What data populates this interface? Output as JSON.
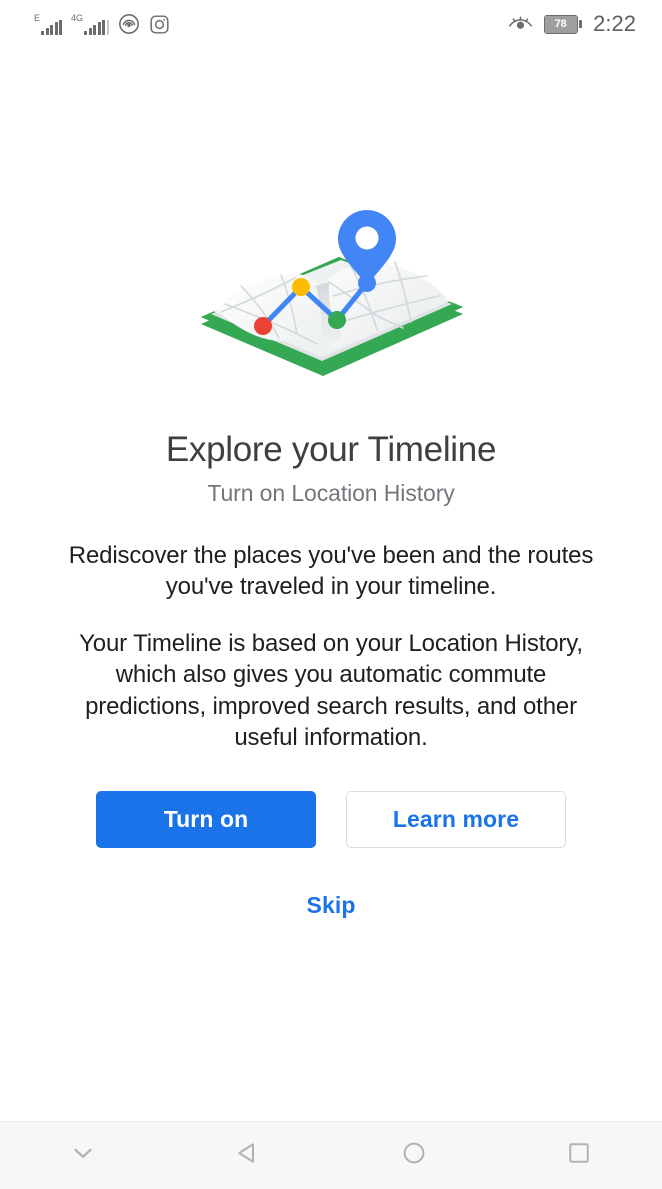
{
  "status_bar": {
    "signal_1_label": "E",
    "signal_2_label": "4G",
    "icons": [
      "signal-e-icon",
      "signal-4g-icon",
      "hotspot-icon",
      "instagram-icon",
      "eye-comfort-icon"
    ],
    "battery_level": "78",
    "time": "2:22"
  },
  "illustration": {
    "name": "timeline-book-map-illustration",
    "book_color": "#34a853",
    "page_color": "#f5f5f5",
    "pin_color": "#4285f4",
    "route_line_color": "#4285f4",
    "route_dots": [
      {
        "name": "route-dot-red",
        "color": "#ea4335"
      },
      {
        "name": "route-dot-yellow",
        "color": "#fbbc04"
      },
      {
        "name": "route-dot-green",
        "color": "#34a853"
      },
      {
        "name": "route-dot-blue",
        "color": "#4285f4"
      }
    ]
  },
  "page": {
    "title": "Explore your Timeline",
    "subtitle": "Turn on Location History",
    "paragraph_1": "Rediscover the places you've been and the routes you've traveled in your timeline.",
    "paragraph_2": "Your Timeline is based on your Location History, which also gives you automatic commute predictions, improved search results, and other useful information."
  },
  "actions": {
    "primary_label": "Turn on",
    "secondary_label": "Learn more",
    "skip_label": "Skip",
    "primary_color": "#1a73e8",
    "link_color": "#1a73e8"
  },
  "nav_bar": {
    "buttons": [
      {
        "name": "nav-hide-button",
        "icon": "chevron-down-icon"
      },
      {
        "name": "nav-back-button",
        "icon": "back-triangle-icon"
      },
      {
        "name": "nav-home-button",
        "icon": "home-circle-icon"
      },
      {
        "name": "nav-recents-button",
        "icon": "recents-square-icon"
      }
    ],
    "icon_color": "#b0b0b0"
  }
}
